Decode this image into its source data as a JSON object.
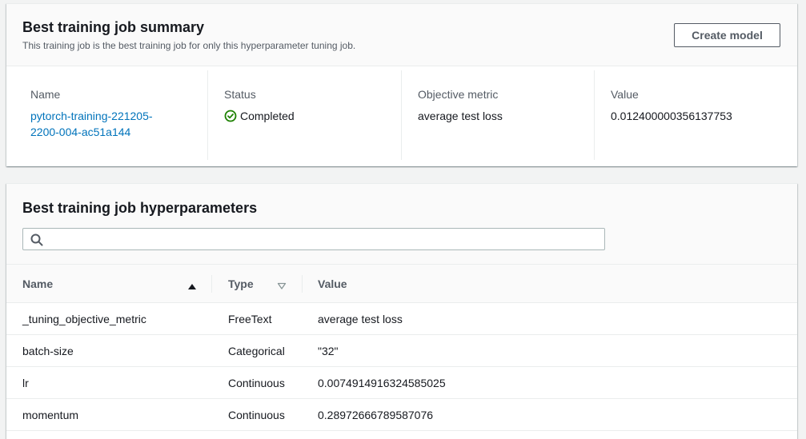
{
  "summary": {
    "title": "Best training job summary",
    "subtitle": "This training job is the best training job for only this hyperparameter tuning job.",
    "create_model_label": "Create model",
    "fields": {
      "name_label": "Name",
      "name_value": "pytorch-training-221205-2200-004-ac51a144",
      "status_label": "Status",
      "status_value": "Completed",
      "objective_label": "Objective metric",
      "objective_value": "average test loss",
      "value_label": "Value",
      "value_value": "0.012400000356137753"
    }
  },
  "hyperparameters": {
    "title": "Best training job hyperparameters",
    "search": {
      "placeholder": "",
      "value": ""
    },
    "columns": {
      "name": "Name",
      "type": "Type",
      "value": "Value"
    },
    "sort": {
      "name": "ascending",
      "type": "unsorted"
    },
    "rows": [
      {
        "name": "_tuning_objective_metric",
        "type": "FreeText",
        "value": "average test loss"
      },
      {
        "name": "batch-size",
        "type": "Categorical",
        "value": "\"32\""
      },
      {
        "name": "lr",
        "type": "Continuous",
        "value": "0.0074914916324585025"
      },
      {
        "name": "momentum",
        "type": "Continuous",
        "value": "0.28972666789587076"
      }
    ]
  },
  "colors": {
    "link": "#0073bb",
    "success": "#1d8102",
    "background": "#f2f3f3"
  },
  "icons": {
    "status": "check-circle-icon",
    "search": "search-icon",
    "sort_name": "caret-up-filled-icon",
    "sort_type": "caret-down-outline-icon"
  }
}
